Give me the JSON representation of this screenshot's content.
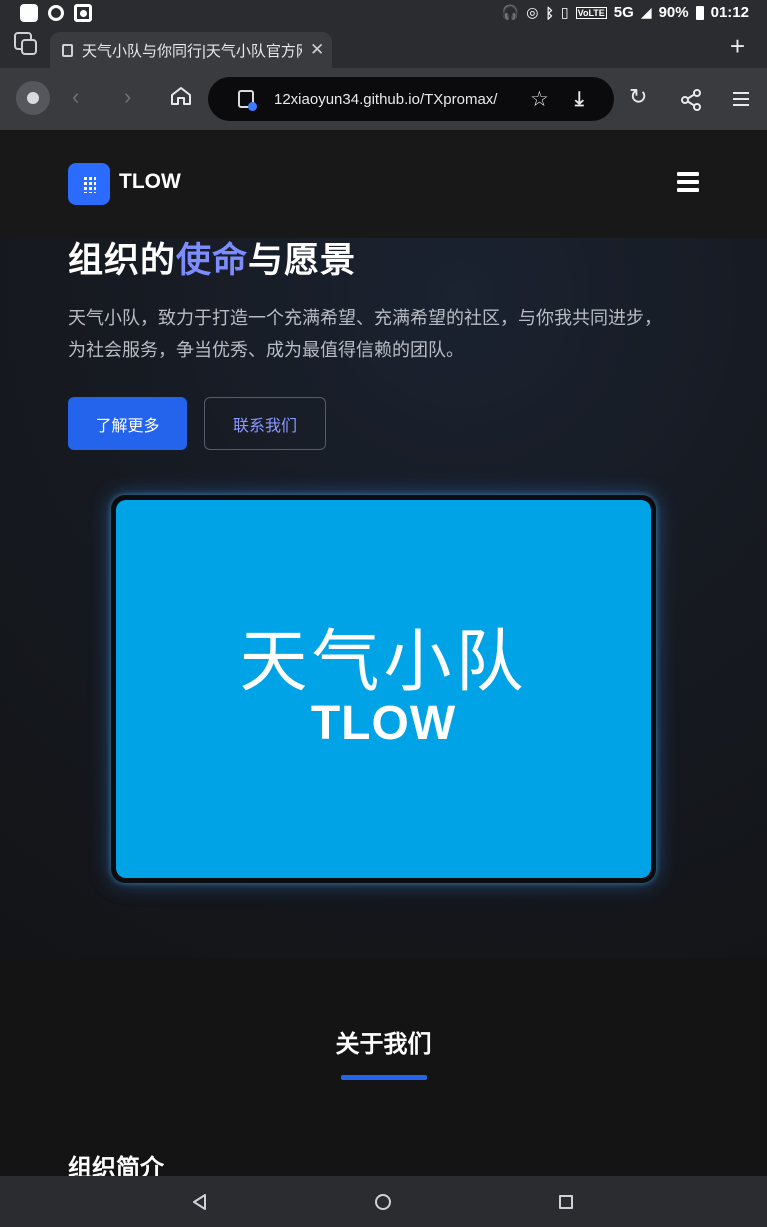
{
  "status_bar": {
    "battery": "90%",
    "time": "01:12",
    "network": "5G",
    "volte": "VoLTE",
    "icons": [
      "headphones-icon",
      "hotspot-icon",
      "bluetooth-icon",
      "vibrate-icon",
      "signal-icon",
      "battery-icon"
    ]
  },
  "browser": {
    "tab_title": "天气小队与你同行|天气小队官方网站",
    "url": "12xiaoyun34.github.io/TXpromax/",
    "new_tab": "+",
    "tab_close": "✕"
  },
  "site": {
    "logo_text": "TLOW",
    "hero": {
      "title_part1": "组织的",
      "title_highlight": "使命",
      "title_part2": "与愿景",
      "description": "天气小队，致力于打造一个充满希望、充满希望的社区，与你我共同进步，为社会服务，争当优秀、成为最值得信赖的团队。",
      "primary_button": "了解更多",
      "secondary_button": "联系我们"
    },
    "card": {
      "title_cn": "天气小队",
      "title_en": "TLOW",
      "bg_color": "#00a3e6"
    },
    "about": {
      "title": "关于我们",
      "subtitle": "组织简介"
    }
  },
  "colors": {
    "accent": "#2463eb",
    "highlight": "#7d8dff"
  }
}
